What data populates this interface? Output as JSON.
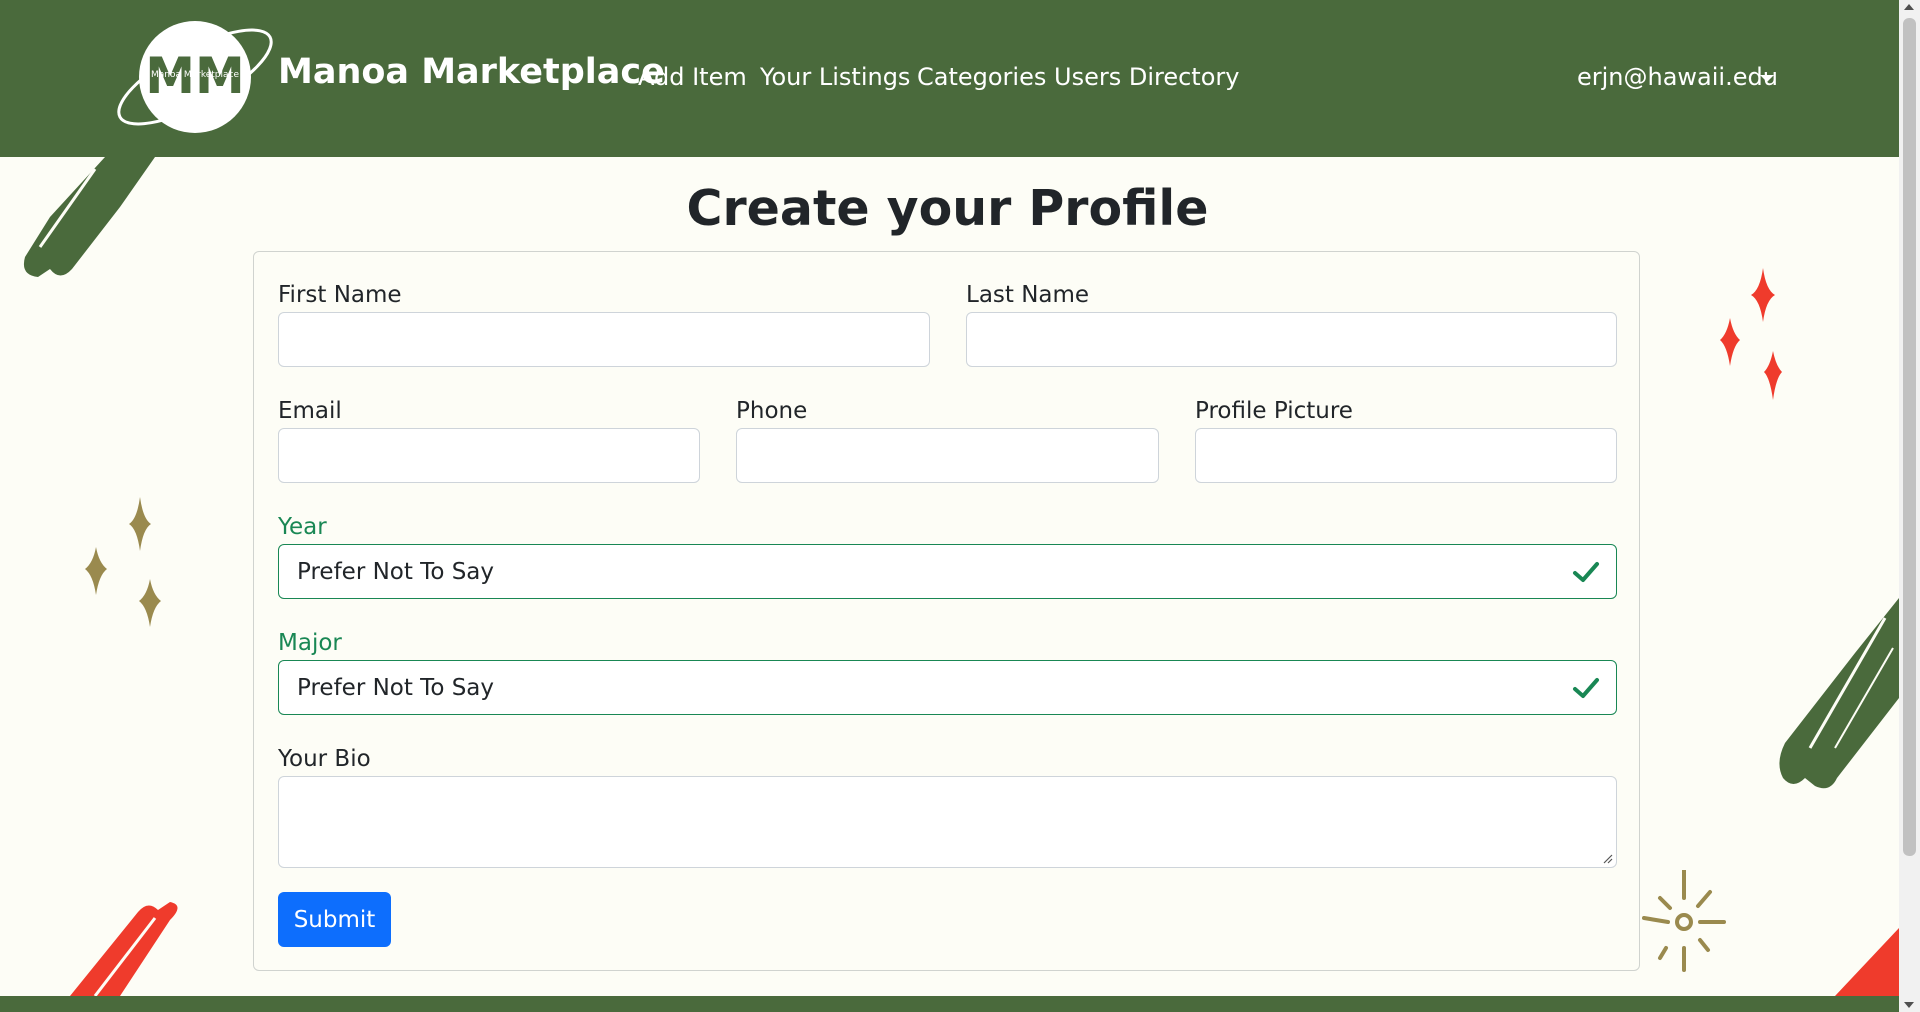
{
  "brand": {
    "name": "Manoa Marketplace",
    "logo_text": "Manoa Marketplace",
    "logo_letters": "MM"
  },
  "nav": {
    "items": [
      "Add Item",
      "Your Listings",
      "Categories",
      "Users Directory"
    ],
    "user": "erjn@hawaii.edu"
  },
  "page": {
    "title": "Create your Profile"
  },
  "form": {
    "first_name": {
      "label": "First Name",
      "value": ""
    },
    "last_name": {
      "label": "Last Name",
      "value": ""
    },
    "email": {
      "label": "Email",
      "value": ""
    },
    "phone": {
      "label": "Phone",
      "value": ""
    },
    "profile_picture": {
      "label": "Profile Picture",
      "value": ""
    },
    "year": {
      "label": "Year",
      "value": "Prefer Not To Say"
    },
    "major": {
      "label": "Major",
      "value": "Prefer Not To Say"
    },
    "bio": {
      "label": "Your Bio",
      "value": ""
    },
    "submit_label": "Submit"
  },
  "colors": {
    "brand_green": "#4a6a3c",
    "valid_green": "#198754",
    "primary_blue": "#0d6efd",
    "accent_red": "#ef3b2c",
    "accent_gold": "#9a8a4e",
    "background": "#fdfdf6"
  },
  "icons": [
    "valid-check-icon",
    "caret-down-icon",
    "resize-grip-icon"
  ]
}
